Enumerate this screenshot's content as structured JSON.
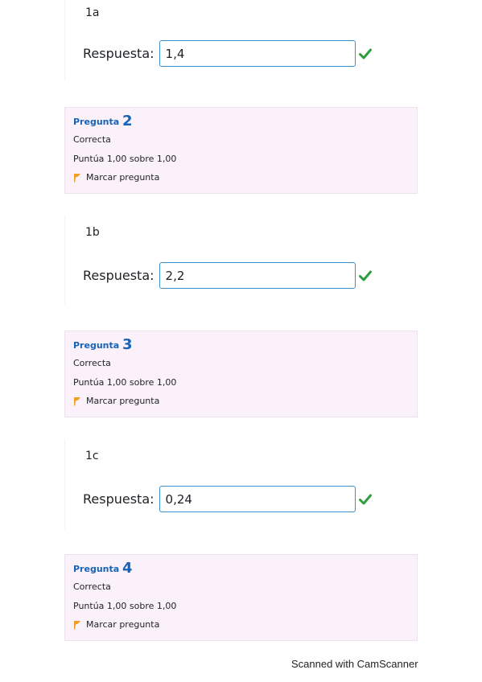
{
  "questions": [
    {
      "text": "1a",
      "answer_label": "Respuesta:",
      "answer_value": "1,4",
      "status_icon": "check-icon"
    },
    {
      "text": "1b",
      "answer_label": "Respuesta:",
      "answer_value": "2,2",
      "status_icon": "check-icon"
    },
    {
      "text": "1c",
      "answer_label": "Respuesta:",
      "answer_value": "0,24",
      "status_icon": "check-icon"
    }
  ],
  "info_boxes": [
    {
      "title_prefix": "Pregunta",
      "number": "2",
      "state": "Correcta",
      "grade": "Puntúa 1,00 sobre 1,00",
      "flag_label": "Marcar pregunta"
    },
    {
      "title_prefix": "Pregunta",
      "number": "3",
      "state": "Correcta",
      "grade": "Puntúa 1,00 sobre 1,00",
      "flag_label": "Marcar pregunta"
    },
    {
      "title_prefix": "Pregunta",
      "number": "4",
      "state": "Correcta",
      "grade": "Puntúa 1,00 sobre 1,00",
      "flag_label": "Marcar pregunta"
    }
  ],
  "colors": {
    "title_blue": "#1763b8",
    "check_green": "#2e9e3e",
    "info_bg": "#fbf1fb",
    "input_border": "#3a8fd1",
    "flag_orange": "#f0a020"
  },
  "watermark": "Scanned with CamScanner"
}
